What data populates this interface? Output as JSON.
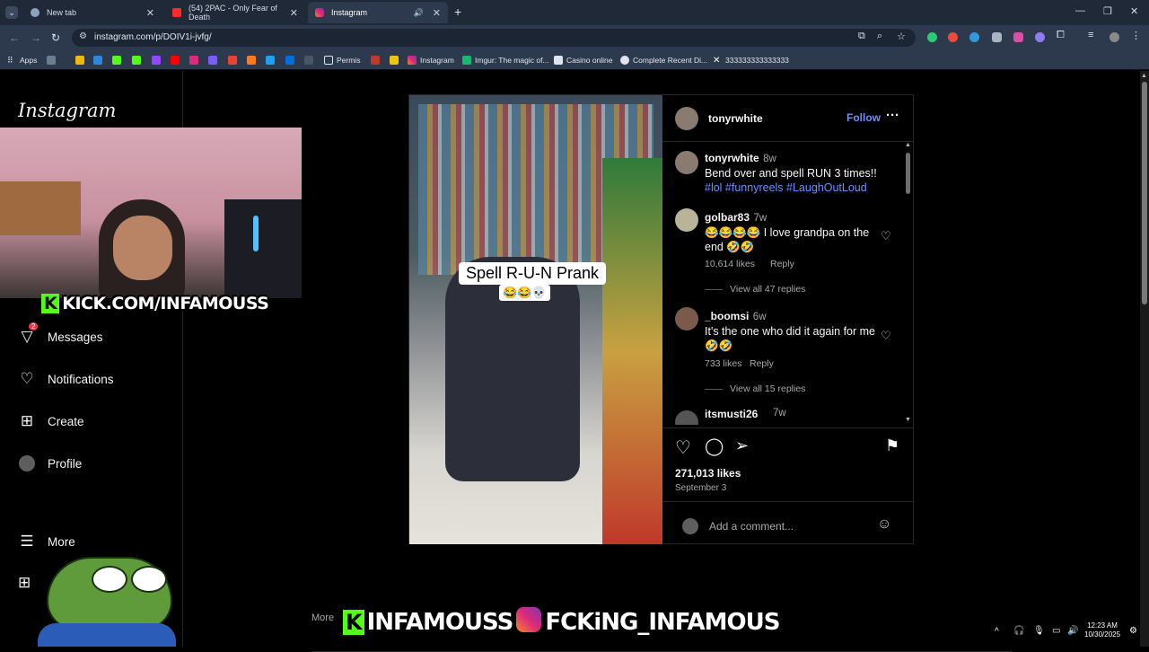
{
  "browser": {
    "tabs": [
      {
        "title": "New tab",
        "active": false
      },
      {
        "title": "(54) 2PAC - Only Fear of Death",
        "active": false
      },
      {
        "title": "Instagram",
        "active": true
      }
    ],
    "new_tab": "+",
    "url": "instagram.com/p/DOIV1i-jvfg/",
    "bookmarks": [
      "Apps",
      "Permis",
      "Instagram",
      "Imgur: The magic of...",
      "Casino online",
      "Complete Recent Di...",
      "333333333333333"
    ]
  },
  "instagram": {
    "logo": "Instagram",
    "nav": [
      {
        "label": "Messages",
        "icon": "messages-icon",
        "badge": "2"
      },
      {
        "label": "Notifications",
        "icon": "heart-icon"
      },
      {
        "label": "Create",
        "icon": "plus-square-icon"
      },
      {
        "label": "Profile",
        "icon": "profile-avatar"
      },
      {
        "label": "More",
        "icon": "menu-icon"
      }
    ],
    "post": {
      "author": "tonyrwhite",
      "follow": "Follow",
      "media_text": "Spell R-U-N Prank",
      "media_emoji": "😂😂💀",
      "caption": {
        "user": "tonyrwhite",
        "time": "8w",
        "text": "Bend over and spell RUN 3 times!!",
        "tags": "#lol #funnyreels #LaughOutLoud"
      },
      "comments": [
        {
          "user": "golbar83",
          "time": "7w",
          "text": "😂😂😂😂 I love grandpa on the end 🤣🤣",
          "likes": "10,614 likes",
          "reply": "Reply",
          "replies": "View all 47 replies"
        },
        {
          "user": "_boomsi",
          "time": "6w",
          "text": "It's the one who did it again for me🤣🤣",
          "likes": "733 likes",
          "reply": "Reply",
          "replies": "View all 15 replies"
        },
        {
          "user": "itsmusti26",
          "time": "7w"
        }
      ],
      "likes": "271,013 likes",
      "date": "September 3",
      "comment_placeholder": "Add a comment..."
    },
    "more_label": "More"
  },
  "overlay": {
    "kick_text": "KICK.COM/INFAMOUSS",
    "bottom_kick": "INFAMOUSS",
    "bottom_ig": "FCKiNG_INFAMOUS"
  },
  "taskbar": {
    "time": "12:23 AM",
    "date": "10/30/2025"
  }
}
